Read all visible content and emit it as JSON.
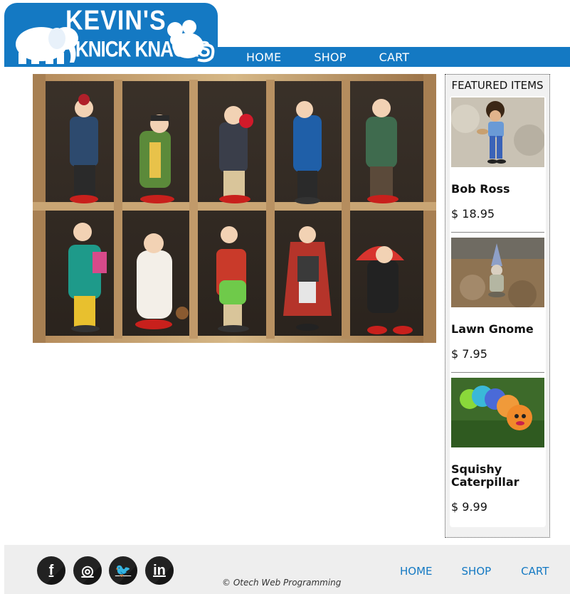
{
  "header": {
    "logo_line1": "KEVIN'S",
    "logo_line2": "KNICK KNACKS",
    "nav": [
      "HOME",
      "SHOP",
      "CART"
    ]
  },
  "sidebar": {
    "title": "FEATURED ITEMS",
    "items": [
      {
        "name": "Bob Ross",
        "price": "$ 18.95"
      },
      {
        "name": "Lawn Gnome",
        "price": "$ 7.95"
      },
      {
        "name": "Squishy Caterpillar",
        "price": "$ 9.99"
      }
    ]
  },
  "footer": {
    "social": [
      {
        "icon": "facebook-icon",
        "glyph": "f"
      },
      {
        "icon": "instagram-icon",
        "glyph": "◎"
      },
      {
        "icon": "twitter-icon",
        "glyph": "🐦"
      },
      {
        "icon": "linkedin-icon",
        "glyph": "in"
      }
    ],
    "copyright": "© Otech Web Programming",
    "nav": [
      "HOME",
      "SHOP",
      "CART"
    ]
  },
  "colors": {
    "brand": "#1479c3",
    "footer_bg": "#eeeeee"
  }
}
